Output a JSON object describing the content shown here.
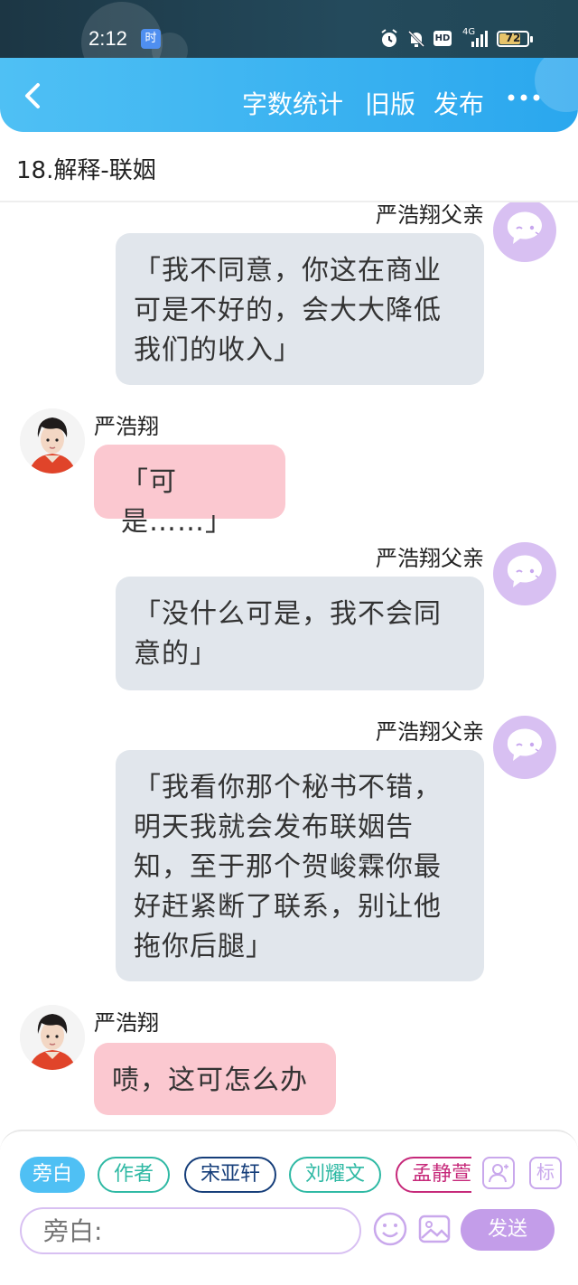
{
  "status_bar": {
    "time": "2:12",
    "app_badge": "时",
    "hd_label": "HD",
    "network": "4G",
    "battery": "72",
    "battery_level": 0.72
  },
  "nav": {
    "actions": [
      "字数统计",
      "旧版",
      "发布"
    ]
  },
  "chapter": {
    "title": "18.解释-联姻"
  },
  "messages": [
    {
      "speaker": "严浩翔父亲",
      "side": "right",
      "text": "「我不同意，你这在商业可是不好的，会大大降低我们的收入」"
    },
    {
      "speaker": "严浩翔",
      "side": "left",
      "text": "「可是……」"
    },
    {
      "speaker": "严浩翔父亲",
      "side": "right",
      "text": "「没什么可是，我不会同意的」"
    },
    {
      "speaker": "严浩翔父亲",
      "side": "right",
      "text": "「我看你那个秘书不错，明天我就会发布联姻告知，至于那个贺峻霖你最好赶紧断了联系，别让他拖你后腿」"
    },
    {
      "speaker": "严浩翔",
      "side": "left",
      "text": "啧，这可怎么办"
    }
  ],
  "composer": {
    "roles": [
      "旁白",
      "作者",
      "宋亚轩",
      "刘耀文",
      "孟静萱"
    ],
    "role_colors": [
      "#4fc0f4",
      "#2fb9a4",
      "#163e7a",
      "#2fb9a4",
      "#c6297a"
    ],
    "tool_icons": [
      "person-add-icon",
      "tag-icon"
    ],
    "tag_label": "标",
    "placeholder": "旁白:",
    "send_label": "发送",
    "accent": "#c39de9"
  }
}
